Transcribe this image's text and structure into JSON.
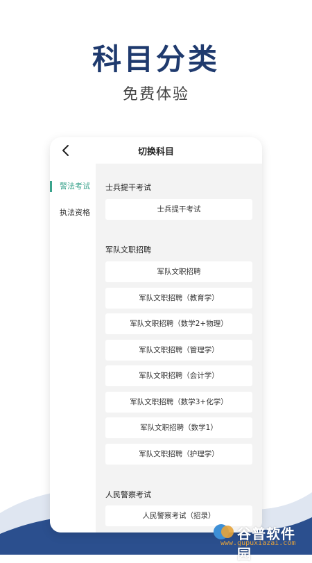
{
  "hero": {
    "title": "科目分类",
    "subtitle": "免费体验"
  },
  "header": {
    "title": "切换科目",
    "back_icon": "chevron-left-icon"
  },
  "sidebar": {
    "items": [
      {
        "label": "警法考试",
        "active": true
      },
      {
        "label": "执法资格",
        "active": false
      }
    ]
  },
  "sections": [
    {
      "title": "士兵提干考试",
      "items": [
        "士兵提干考试"
      ]
    },
    {
      "title": "军队文职招聘",
      "items": [
        "军队文职招聘",
        "军队文职招聘（教育学）",
        "军队文职招聘（数学2+物理）",
        "军队文职招聘（管理学）",
        "军队文职招聘（会计学）",
        "军队文职招聘（数学3+化学）",
        "军队文职招聘（数学1）",
        "军队文职招聘（护理学）"
      ]
    },
    {
      "title": "人民警察考试",
      "items": [
        "人民警察考试（招录）"
      ]
    }
  ],
  "watermark": {
    "name": "谷普软件园",
    "url": "www.gupuxiazai.com"
  },
  "colors": {
    "title_navy": "#1f3a6e",
    "accent_green": "#3aa38c",
    "wave_blue": "#2b4f8e"
  }
}
